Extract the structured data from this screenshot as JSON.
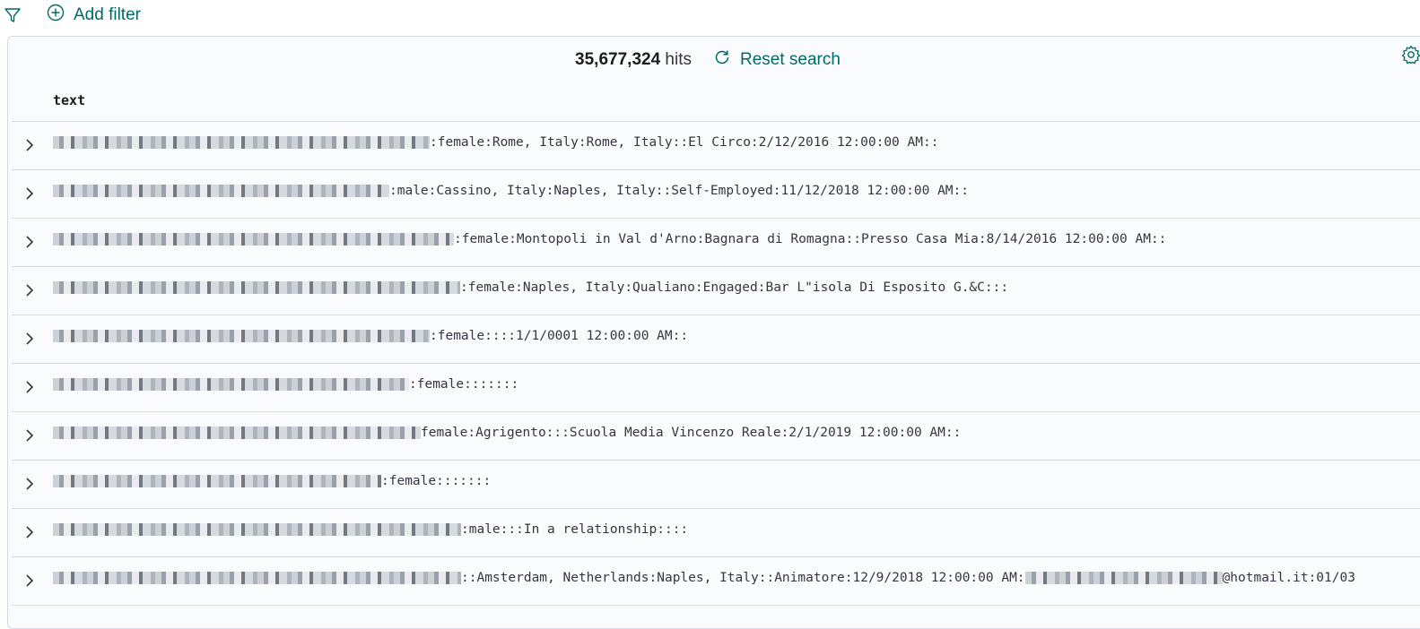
{
  "filter_bar": {
    "filter_icon": "funnel-icon",
    "add_filter_label": "Add filter"
  },
  "results": {
    "hits_count": "35,677,324",
    "hits_label": "hits",
    "reset_label": "Reset search",
    "column_header": "text"
  },
  "rows": [
    {
      "text": ":female:Rome, Italy:Rome, Italy::El Circo:2/12/2016 12:00:00 AM::"
    },
    {
      "text": ":male:Cassino, Italy:Naples, Italy::Self-Employed:11/12/2018 12:00:00 AM::"
    },
    {
      "text": ":female:Montopoli in Val d'Arno:Bagnara di Romagna::Presso Casa Mia:8/14/2016 12:00:00 AM::"
    },
    {
      "text": ":female:Naples, Italy:Qualiano:Engaged:Bar L\"isola Di Esposito G.&C:::"
    },
    {
      "text": ":female::::1/1/0001 12:00:00 AM::"
    },
    {
      "text": ":female:::::::"
    },
    {
      "text": "female:Agrigento:::Scuola Media Vincenzo Reale:2/1/2019 12:00:00 AM::"
    },
    {
      "text": ":female:::::::"
    },
    {
      "text": ":male:::In a relationship::::"
    },
    {
      "text": "::Amsterdam, Netherlands:Naples, Italy::Animatore:12/9/2018 12:00:00 AM:",
      "suffix": "@hotmail.it:01/03"
    }
  ],
  "colors": {
    "accent": "#006b64",
    "border": "#d3dae6",
    "text": "#343741"
  }
}
